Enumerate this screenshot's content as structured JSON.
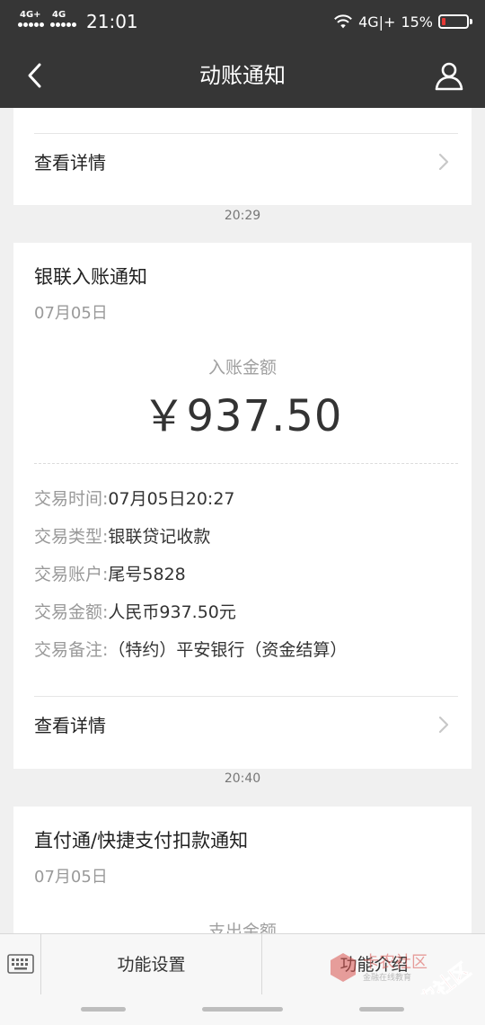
{
  "status_bar": {
    "sim1": "4G+",
    "sim2": "4G",
    "time": "21:01",
    "network": "4G|+",
    "battery_percent": "15%",
    "battery_level": 0.15,
    "battery_color": "#e53935",
    "icons": [
      "wifi-icon",
      "battery-icon"
    ]
  },
  "nav": {
    "title": "动账通知",
    "back_icon": "chevron-left-icon",
    "user_icon": "user-icon"
  },
  "cards": [
    {
      "detail_label": "查看详情"
    },
    {
      "timestamp": "20:29",
      "title": "银联入账通知",
      "date": "07月05日",
      "amount_label": "入账金额",
      "amount": "￥937.50",
      "rows": [
        {
          "key": "交易时间:",
          "value": "07月05日20:27"
        },
        {
          "key": "交易类型:",
          "value": "银联贷记收款"
        },
        {
          "key": "交易账户:",
          "value": "尾号5828"
        },
        {
          "key": "交易金额:",
          "value": "人民币937.50元"
        },
        {
          "key": "交易备注:",
          "value": "（特约）平安银行（资金结算）"
        }
      ],
      "detail_label": "查看详情"
    },
    {
      "timestamp": "20:40",
      "title": "直付通/快捷支付扣款通知",
      "date": "07月05日",
      "amount_label": "支出金额"
    }
  ],
  "bottom_bar": {
    "keyboard_icon": "keyboard-icon",
    "tab1": "功能设置",
    "tab2": "功能介绍"
  },
  "watermark": {
    "line1": "卡农社区",
    "line2": "卡农社区",
    "sub": "金融在线教育"
  }
}
